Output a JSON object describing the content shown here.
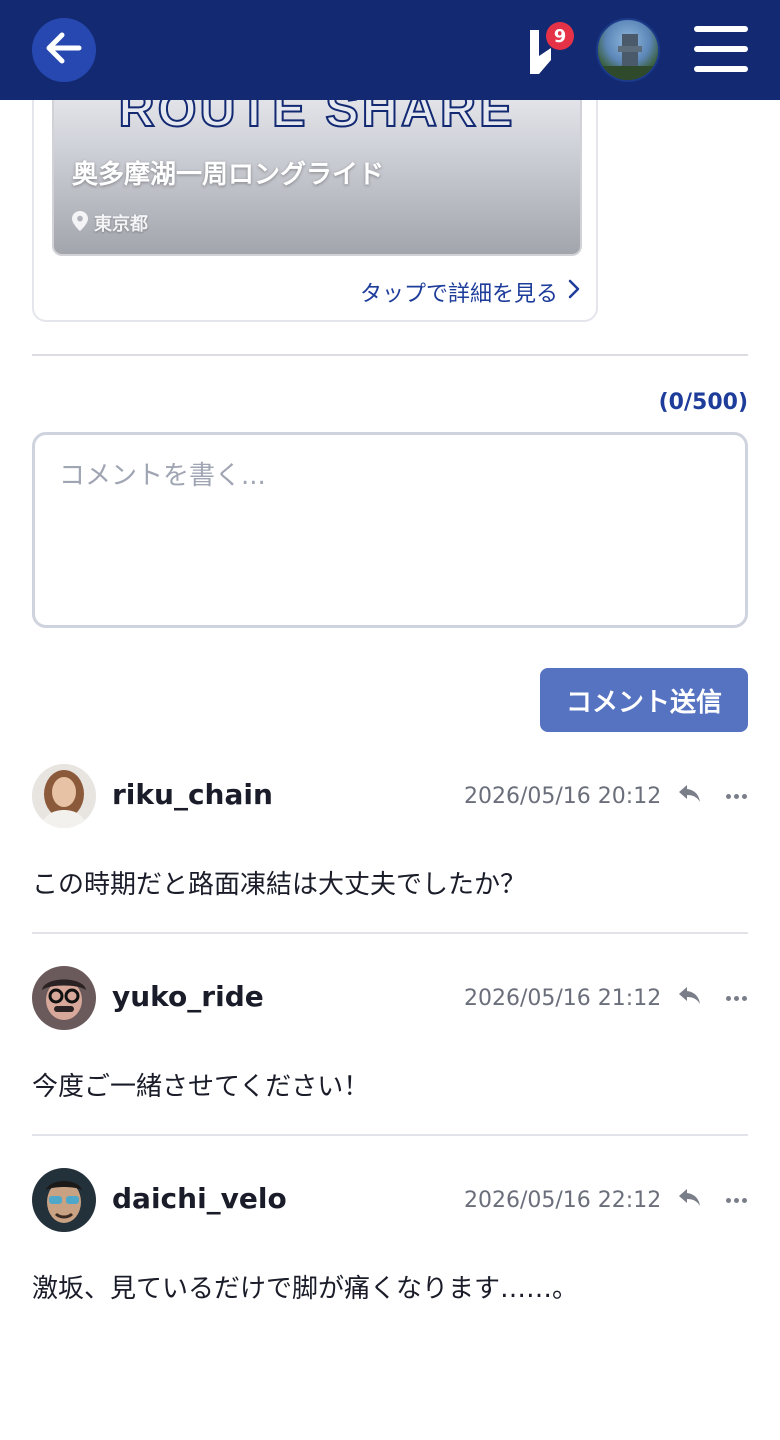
{
  "header": {
    "notification_count": "9"
  },
  "route": {
    "brand": "ROUTE SHARE",
    "title": "奥多摩湖一周ロングライド",
    "location": "東京都",
    "detail_link": "タップで詳細を見る"
  },
  "comment_form": {
    "char_count": "(0/500)",
    "placeholder": "コメントを書く...",
    "submit_label": "コメント送信"
  },
  "comments": [
    {
      "user": "riku_chain",
      "time": "2026/05/16 20:12",
      "text": "この時期だと路面凍結は大丈夫でしたか？"
    },
    {
      "user": "yuko_ride",
      "time": "2026/05/16 21:12",
      "text": "今度ご一緒させてください！"
    },
    {
      "user": "daichi_velo",
      "time": "2026/05/16 22:12",
      "text": "激坂、見ているだけで脚が痛くなります……。"
    }
  ],
  "colors": {
    "header_bg": "#132a73",
    "accent": "#1e3d9b",
    "button_bg": "#5673c2",
    "badge": "#e53247"
  }
}
